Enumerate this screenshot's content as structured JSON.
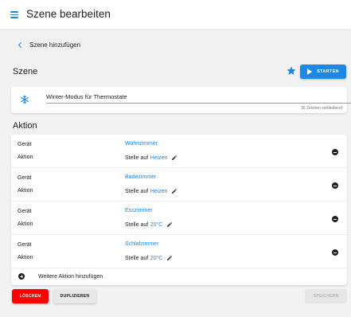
{
  "header": {
    "title": "Szene bearbeiten",
    "menu_icon": "hamburger-menu-icon"
  },
  "breadcrumb": {
    "back_label": "Szene hinzufügen",
    "back_icon": "chevron-left-icon"
  },
  "scene": {
    "section_title": "Szene",
    "favorite_icon": "star-icon",
    "start_label": "STARTEN",
    "start_icon": "play-icon",
    "scene_icon": "snowflake-icon",
    "name_value": "Winter-Modus für Thermostate",
    "char_count": "36 Zeichen verbleibend"
  },
  "actions": {
    "section_title": "Aktion",
    "device_label": "Gerät",
    "action_label": "Aktion",
    "prefix": "Stelle auf",
    "items": [
      {
        "room": "Wohnzimmer",
        "value": "Heizen"
      },
      {
        "room": "Badezimmer",
        "value": "Heizen"
      },
      {
        "room": "Esszimmer",
        "value": "20°C"
      },
      {
        "room": "Schlafzimmer",
        "value": "20°C"
      }
    ],
    "add_label": "Weitere Aktion hinzufügen"
  },
  "footer": {
    "delete_label": "LÖSCHEN",
    "duplicate_label": "DUPLIZIEREN",
    "save_label": "SPEICHERN"
  },
  "colors": {
    "accent": "#1e88e5",
    "danger": "#ff0000",
    "background": "#f2f2f2"
  }
}
